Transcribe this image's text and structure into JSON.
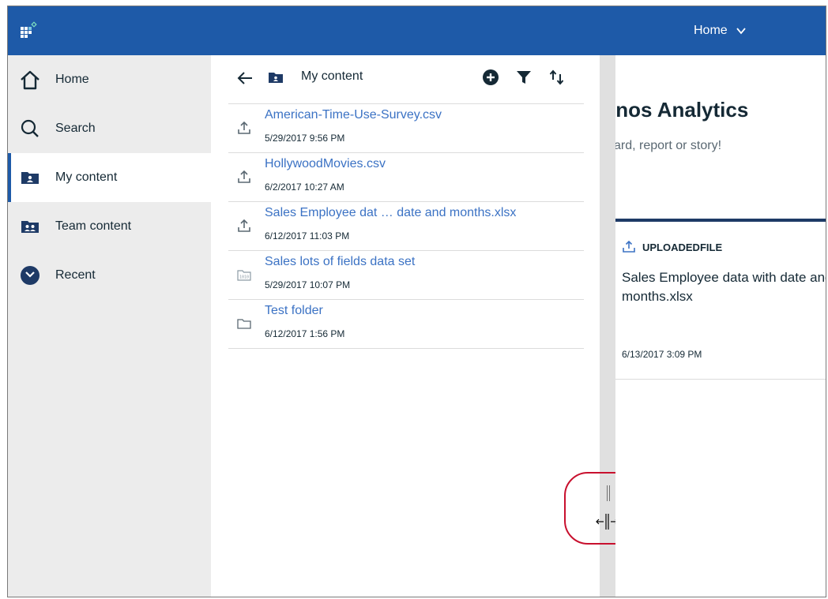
{
  "topbar": {
    "home_menu_label": "Home"
  },
  "nav": {
    "items": [
      {
        "label": "Home",
        "icon": "home-icon"
      },
      {
        "label": "Search",
        "icon": "search-icon"
      },
      {
        "label": "My content",
        "icon": "folder-user-icon"
      },
      {
        "label": "Team content",
        "icon": "folder-team-icon"
      },
      {
        "label": "Recent",
        "icon": "clock-icon"
      }
    ],
    "active": "My content"
  },
  "panel": {
    "title": "My content",
    "rows": [
      {
        "name": "American-Time-Use-Survey.csv",
        "date": "5/29/2017 9:56 PM",
        "icon": "upload-icon"
      },
      {
        "name": "HollywoodMovies.csv",
        "date": "6/2/2017 10:27 AM",
        "icon": "upload-icon"
      },
      {
        "name": "Sales Employee dat … date and months.xlsx",
        "date": "6/12/2017 11:03 PM",
        "icon": "upload-icon"
      },
      {
        "name": "Sales lots of fields data set",
        "date": "5/29/2017 10:07 PM",
        "icon": "data-set-icon"
      },
      {
        "name": "Test folder",
        "date": "6/12/2017 1:56 PM",
        "icon": "folder-icon"
      }
    ]
  },
  "background": {
    "welcome_title": "ınos Analytics",
    "welcome_subtitle": "ard, report or story!",
    "card": {
      "type": "UPLOADEDFILE",
      "name": "Sales Employee data with date and months.xlsx",
      "date": "6/13/2017 3:09 PM"
    }
  },
  "colors": {
    "brand_blue": "#1e5aa8",
    "link_blue": "#3b72c4",
    "nav_bg": "#ececec",
    "callout_red": "#c8102e"
  }
}
